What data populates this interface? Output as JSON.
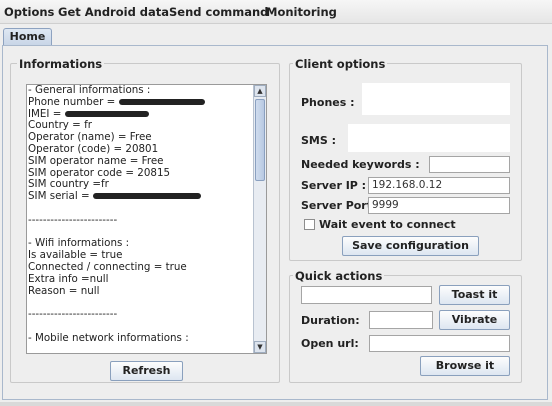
{
  "menu": [
    "Options",
    "Get Android data",
    "Send command",
    "Monitoring"
  ],
  "tab": "Home",
  "informations": {
    "title": "Informations",
    "lines": [
      " - General informations :",
      "Phone number = ",
      "IMEI = ",
      "Country = fr",
      "Operator (name) = Free",
      "Operator (code) = 20801",
      "SIM operator name = Free",
      "SIM operator code = 20815",
      "SIM country =fr",
      "SIM serial = ",
      "",
      "------------------------",
      "",
      " - Wifi informations :",
      "Is available = true",
      "Connected / connecting = true",
      "Extra info =null",
      "Reason = null",
      "",
      "------------------------",
      "",
      " - Mobile network informations :"
    ],
    "refresh_label": "Refresh"
  },
  "client_options": {
    "title": "Client options",
    "phones_label": "Phones :",
    "sms_label": "SMS :",
    "keywords_label": "Needed keywords :",
    "keywords_value": "",
    "server_ip_label": "Server IP :",
    "server_ip_value": "192.168.0.12",
    "server_port_label": "Server Port :",
    "server_port_value": "9999",
    "wait_label": "Wait event to connect",
    "wait_checked": false,
    "save_label": "Save configuration"
  },
  "quick_actions": {
    "title": "Quick actions",
    "toast_value": "",
    "toast_label": "Toast it",
    "duration_label": "Duration:",
    "duration_value": "",
    "vibrate_label": "Vibrate",
    "open_url_label": "Open url:",
    "open_url_value": "",
    "browse_label": "Browse it"
  }
}
